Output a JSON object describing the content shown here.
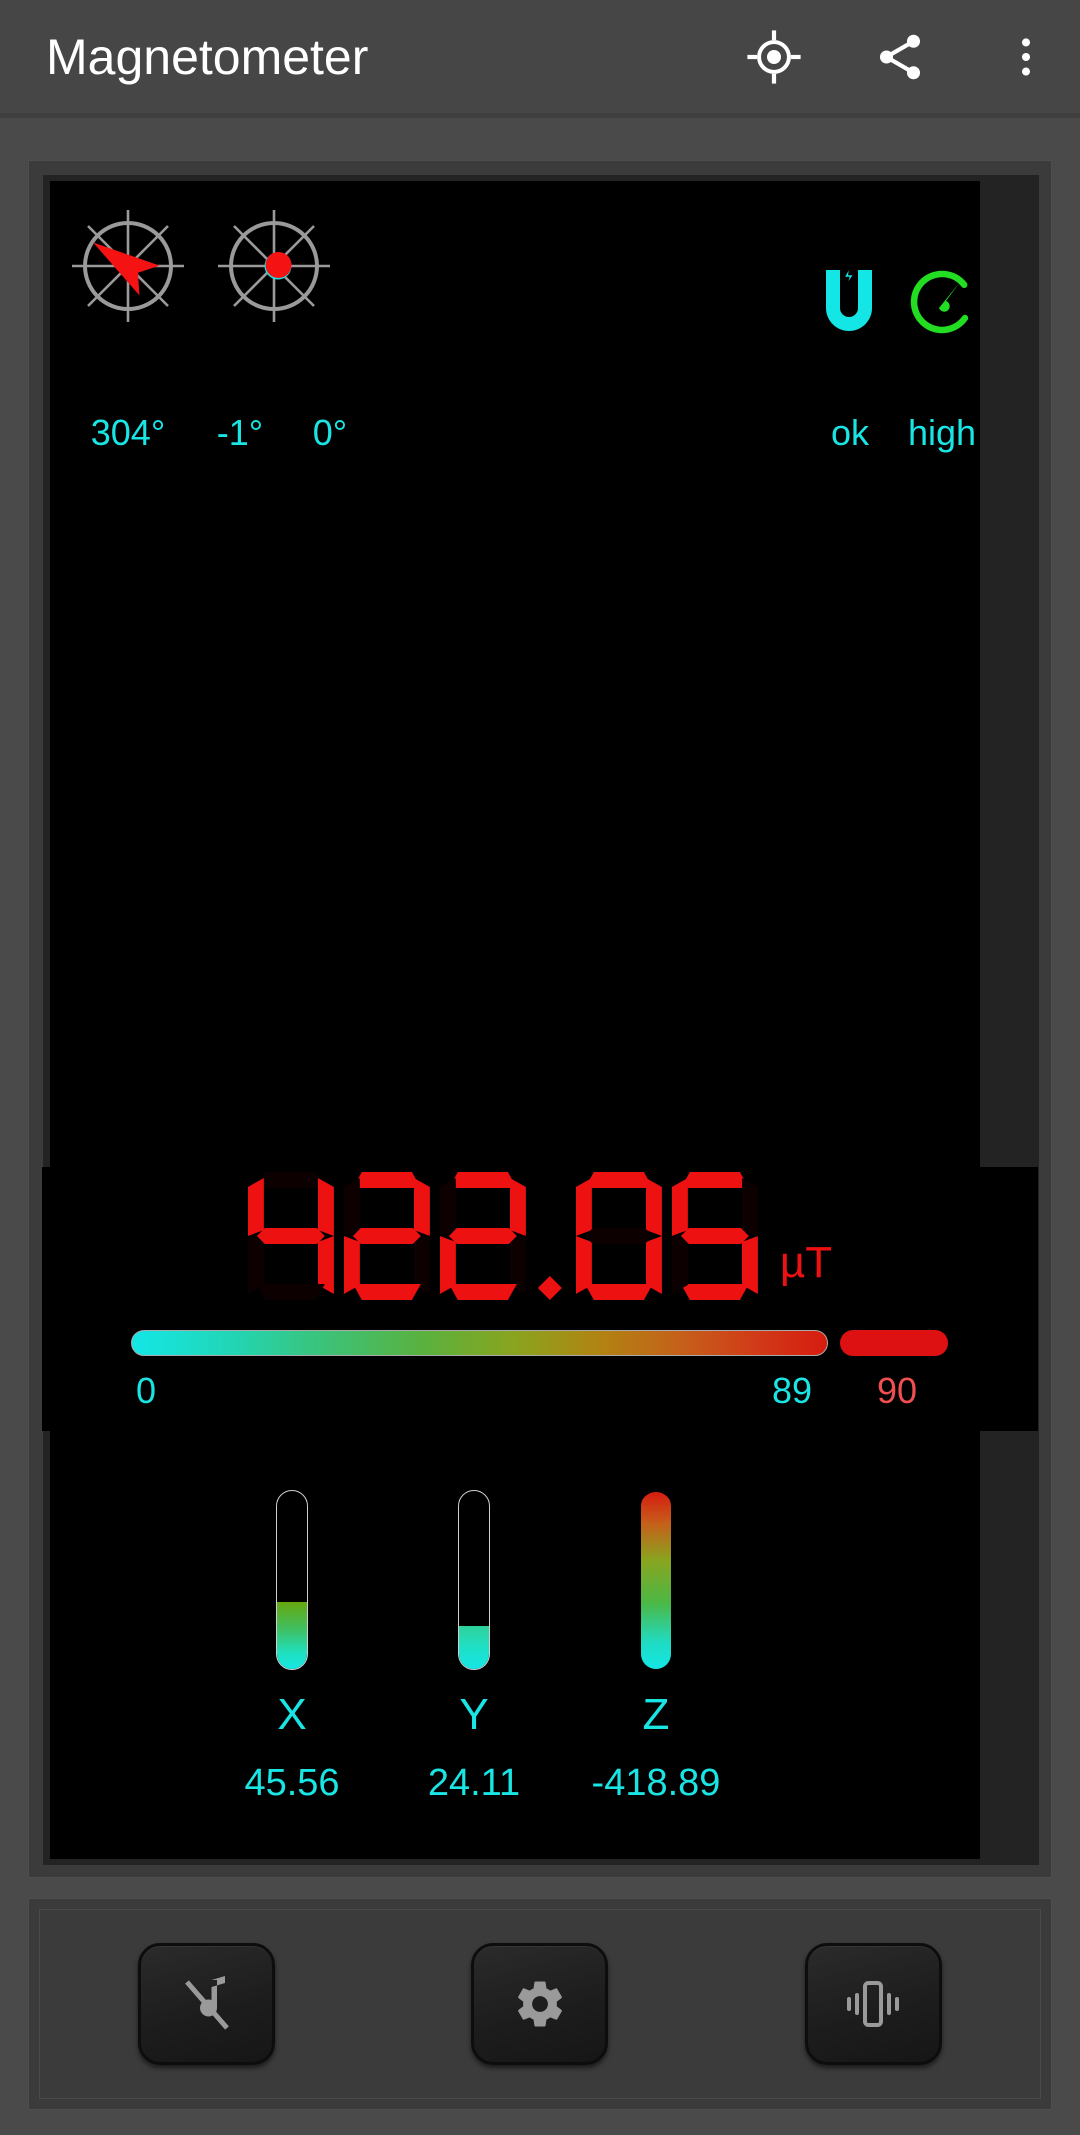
{
  "app": {
    "title": "Magnetometer"
  },
  "appbar": {
    "actions": [
      {
        "name": "calibrate-location-icon",
        "label": "calibrate"
      },
      {
        "name": "share-icon",
        "label": "share"
      },
      {
        "name": "overflow-menu-icon",
        "label": "more options"
      }
    ]
  },
  "compass": {
    "heading_label": "304°",
    "heading_deg": 304,
    "pitch_label": "-1°",
    "pitch_deg": -1,
    "roll_label": "0°",
    "roll_deg": 0
  },
  "status": {
    "sensor": {
      "icon": "magnet-icon",
      "label": "ok",
      "color": "#14e6e6"
    },
    "accuracy": {
      "icon": "speedometer-icon",
      "label": "high",
      "color": "#22dd22"
    }
  },
  "readout": {
    "value": "422.05",
    "digits": [
      "4",
      "2",
      "2",
      ".",
      "0",
      "5"
    ],
    "unit": "µT",
    "color": "#ee1111"
  },
  "scale_bar": {
    "min_label": "0",
    "max_label": "89",
    "over_label": "90",
    "min": 0,
    "max": 89,
    "over": 90
  },
  "axes": [
    {
      "name": "X",
      "value": "45.56",
      "fill_percent": 38
    },
    {
      "name": "Y",
      "value": "24.11",
      "fill_percent": 25
    },
    {
      "name": "Z",
      "value": "-418.89",
      "fill_percent": 100
    }
  ],
  "toolbar": {
    "buttons": [
      {
        "name": "sound-off-button",
        "icon": "music-note-off-icon",
        "label": "sound off"
      },
      {
        "name": "settings-button",
        "icon": "gear-icon",
        "label": "settings"
      },
      {
        "name": "vibrate-button",
        "icon": "vibrate-icon",
        "label": "vibrate"
      }
    ]
  },
  "colors": {
    "cyan": "#1ae5e5",
    "red": "#ee1111",
    "green": "#22dd22",
    "panel": "#3b3b3b",
    "appbar": "#464646",
    "screen": "#000000"
  }
}
